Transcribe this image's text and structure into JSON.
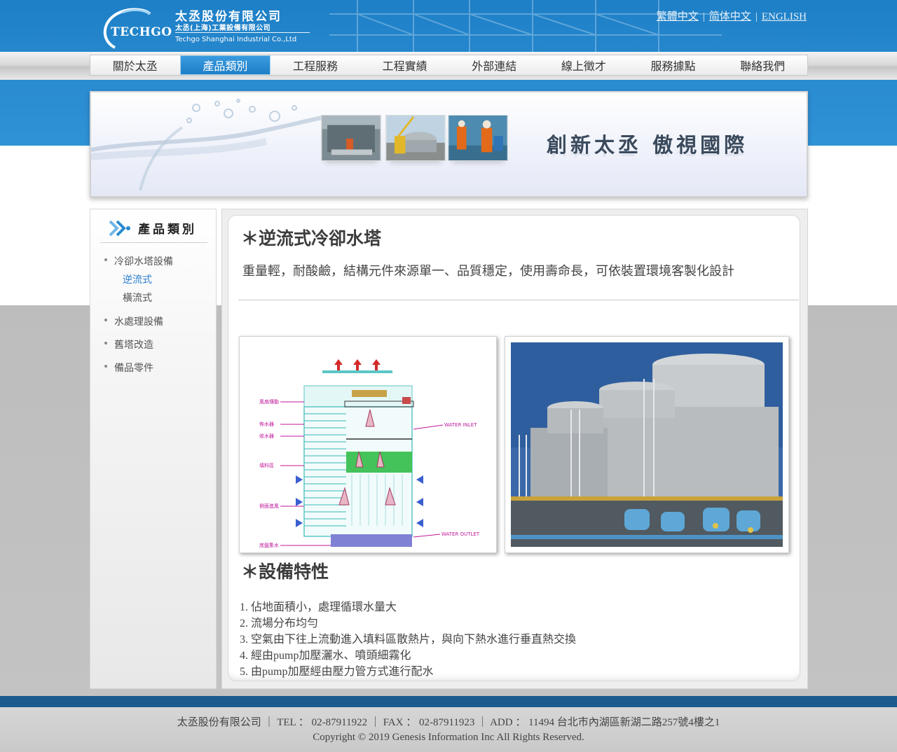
{
  "header": {
    "logo_text": "TECHGO",
    "company_cn": "太丞股份有限公司",
    "company_cn_sub": "太丞(上海)工業設備有限公司",
    "company_en": "Techgo Shanghai Industrial Co.,Ltd"
  },
  "languages": [
    {
      "label": "繁體中文"
    },
    {
      "label": "简体中文"
    },
    {
      "label": "ENGLISH"
    }
  ],
  "lang_separator": "|",
  "nav": {
    "items": [
      {
        "label": "關於太丞"
      },
      {
        "label": "產品類別",
        "active": true
      },
      {
        "label": "工程服務"
      },
      {
        "label": "工程實績"
      },
      {
        "label": "外部連結"
      },
      {
        "label": "線上徵才"
      },
      {
        "label": "服務據點"
      },
      {
        "label": "聯絡我們"
      }
    ]
  },
  "banner": {
    "slogan": "創新太丞  傲視國際"
  },
  "sidebar": {
    "title": "產品類別",
    "categories": [
      {
        "label": "冷卻水塔設備",
        "children": [
          {
            "label": "逆流式",
            "active": true
          },
          {
            "label": "橫流式"
          }
        ]
      },
      {
        "label": "水處理設備"
      },
      {
        "label": "舊塔改造"
      },
      {
        "label": "備品零件"
      }
    ]
  },
  "main": {
    "title": "＊逆流式冷卻水塔",
    "description": "重量輕，耐酸鹼，結構元件來源單一、品質穩定，使用壽命長，可依裝置環境客製化設計",
    "diagram_labels": {
      "water_inlet": "WATER INLET",
      "water_outlet": "WATER OUTLET",
      "part_fan": "風扇傳動",
      "part_distributor": "佈水器",
      "part_eliminator": "收水器",
      "part_fill": "填料區",
      "part_louver": "側面進風",
      "part_basin": "底盤集水"
    },
    "features_title": "＊設備特性",
    "features": [
      "1. 佔地面積小，處理循環水量大",
      "2. 流場分布均勻",
      "3. 空氣由下往上流動進入填料區散熱片，與向下熱水進行垂直熱交換",
      "4. 經由pump加壓灑水、噴頭細霧化",
      "5. 由pump加壓經由壓力管方式進行配水"
    ]
  },
  "footer": {
    "line1": "太丞股份有限公司 ｜ TEL ： 02-87911922 ｜ FAX ： 02-87911923 ｜ ADD ： 11494 台北市內湖區新湖二路257號4樓之1",
    "line2": "Copyright © 2019 Genesis Information Inc All Rights Reserved."
  },
  "colors": {
    "header_blue": "#1d7fc6",
    "nav_active": "#2a8bd0",
    "sidebar_active": "#2a7fd0",
    "diagram_label": "#c0189a",
    "footer_bar": "#1b5b8e"
  }
}
